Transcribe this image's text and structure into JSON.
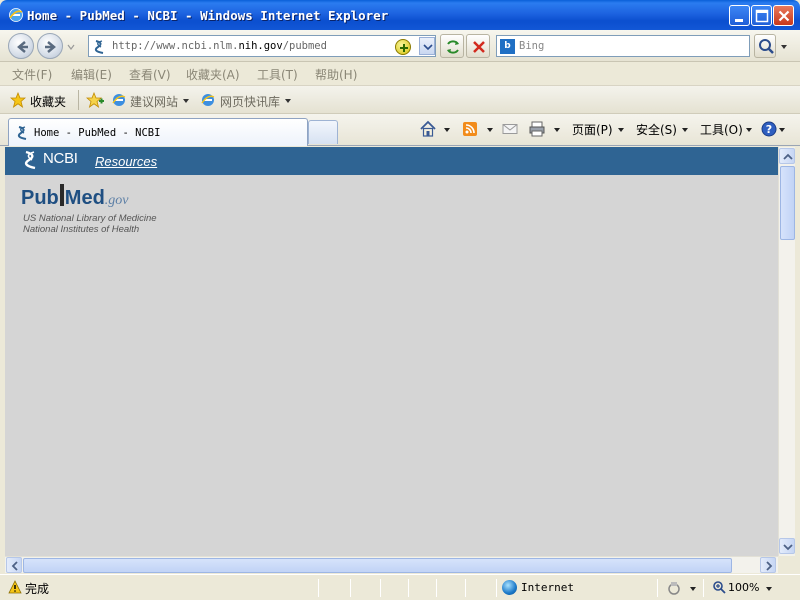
{
  "window": {
    "title": "Home - PubMed - NCBI - Windows Internet Explorer"
  },
  "address_bar": {
    "url_prefix": "http://www.ncbi.nlm.",
    "url_domain": "nih.gov",
    "url_suffix": "/pubmed"
  },
  "search": {
    "placeholder": "Bing"
  },
  "menu": {
    "items": [
      "文件(F)",
      "编辑(E)",
      "查看(V)",
      "收藏夹(A)",
      "工具(T)",
      "帮助(H)"
    ]
  },
  "favorites_bar": {
    "label": "收藏夹",
    "links": [
      "建议网站",
      "网页快讯库"
    ]
  },
  "tab": {
    "title": "Home - PubMed - NCBI"
  },
  "command_bar": {
    "page": "页面(P)",
    "safety": "安全(S)",
    "tools": "工具(O)"
  },
  "content": {
    "ncbi_label": "NCBI",
    "resources_link": "Resources",
    "logo_pub": "Pub",
    "logo_med": "Med",
    "logo_gov": ".gov",
    "org_line_1": "US National Library of Medicine",
    "org_line_2": "National Institutes of Health",
    "background_color": "#d5d5d5",
    "header_color": "#2f6493"
  },
  "status_bar": {
    "text": "完成",
    "zone": "Internet",
    "zoom": "100%"
  },
  "icons": [
    "ie-icon",
    "back-icon",
    "forward-icon",
    "refresh-icon",
    "stop-icon",
    "search-icon",
    "favorites-star-icon",
    "add-favorites-icon",
    "home-icon",
    "rss-icon",
    "mail-icon",
    "print-icon",
    "help-icon",
    "globe-icon",
    "zoom-icon",
    "warning-icon",
    "protected-mode-icon"
  ]
}
